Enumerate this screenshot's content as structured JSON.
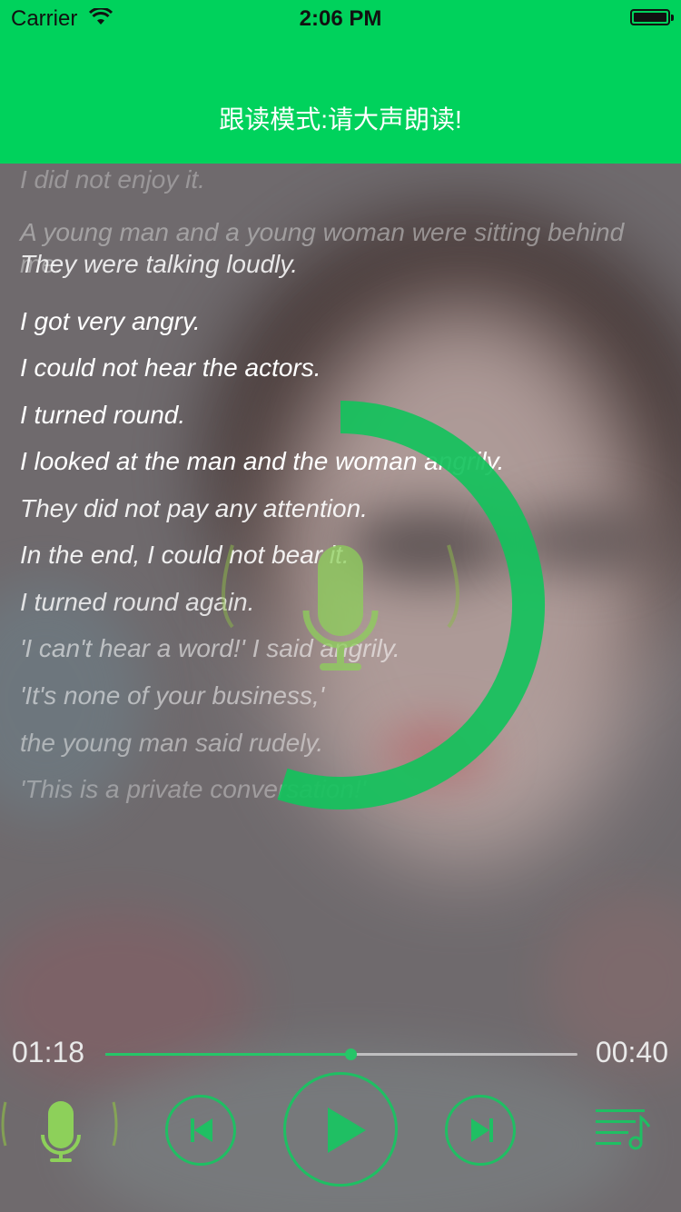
{
  "status_bar": {
    "carrier": "Carrier",
    "time": "2:06 PM"
  },
  "header": {
    "title": "跟读模式:请大声朗读!",
    "color": "#00d25c"
  },
  "lyrics": [
    {
      "text": "I did not enjoy it.",
      "state": "past"
    },
    {
      "text": "A young man and a young woman were sitting behind me.",
      "state": "past"
    },
    {
      "text": "They were talking loudly.",
      "state": "near"
    },
    {
      "text": "I got very angry.",
      "state": "current"
    },
    {
      "text": "I could not hear the actors.",
      "state": "current"
    },
    {
      "text": "I turned round.",
      "state": "near"
    },
    {
      "text": "I looked at the man and the woman angrily.",
      "state": "near"
    },
    {
      "text": "They did not pay any attention.",
      "state": "near"
    },
    {
      "text": "In the end, I could not bear it.",
      "state": "near"
    },
    {
      "text": "I turned round again.",
      "state": "near"
    },
    {
      "text": "'I can't hear a word!' I said angrily.",
      "state": "far"
    },
    {
      "text": "'It's none of your business,'",
      "state": "far"
    },
    {
      "text": "the young man said rudely.",
      "state": "far"
    },
    {
      "text": "'This is a private conversation!'",
      "state": "faded"
    }
  ],
  "recording": {
    "progress": 0.55,
    "icon": "microphone-icon",
    "accent": "#14c25c"
  },
  "player": {
    "elapsed": "01:18",
    "remaining": "00:40",
    "progress": 0.52,
    "accent": "#1fbf63",
    "mic_color": "#8dd05a"
  }
}
